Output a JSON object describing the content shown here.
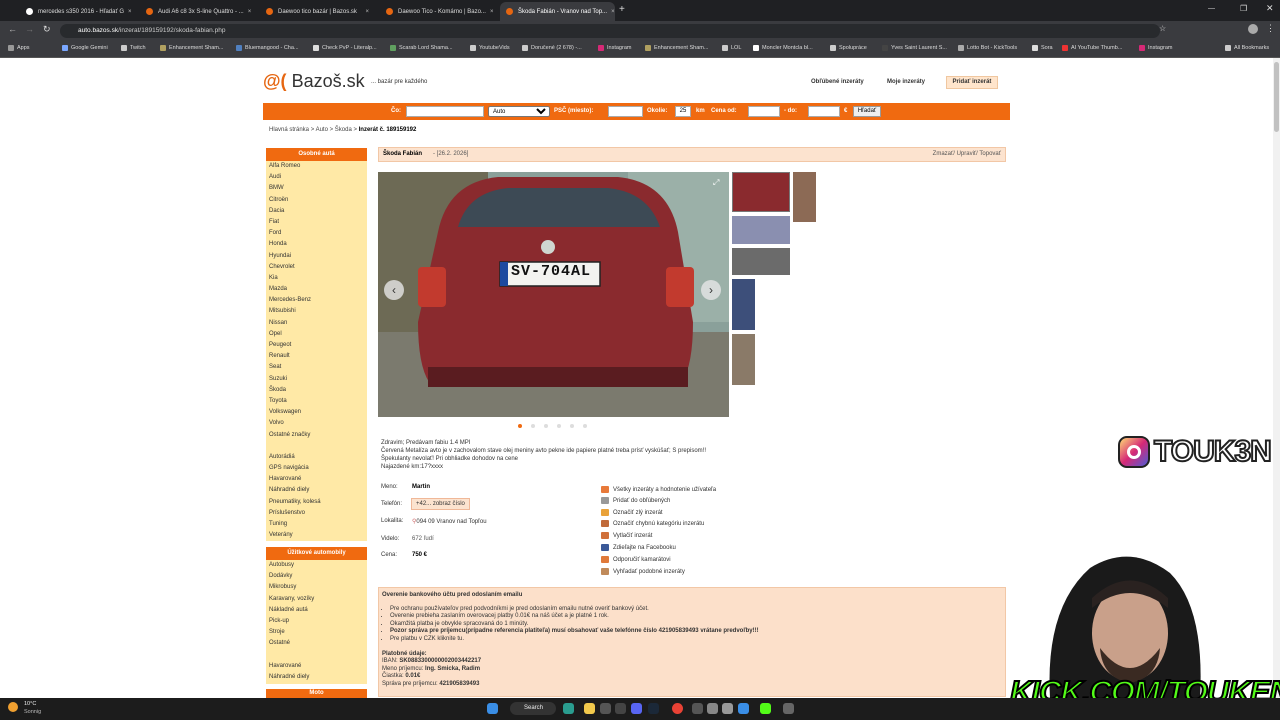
{
  "browser": {
    "tabs": [
      {
        "title": "mercedes s350 2016 - Hľadať G",
        "active": false
      },
      {
        "title": "Audi A6 c8 3x S-line Quattro - ...",
        "active": false
      },
      {
        "title": "Daewoo tico bazár | Bazos.sk",
        "active": false
      },
      {
        "title": "Daewoo Tico - Komárno | Bazo...",
        "active": false
      },
      {
        "title": "Škoda Fabián - Vranov nad Top...",
        "active": true
      }
    ],
    "new_tab": "+",
    "url_host": "auto.bazos.sk",
    "url_path": "/inzerat/189159192/skoda-fabian.php",
    "bookmarks": [
      "Apps",
      "Google Gemini",
      "Twitch",
      "Enhancement Sham...",
      "Bluemangood - Cha...",
      "Check PvP - Literalp...",
      "Scarab Lord Shama...",
      "YoutubeVids",
      "Doručené (2 678) -...",
      "Instagram",
      "Enhancement Sham...",
      "LOL",
      "Moncler Montcla bl...",
      "Spolupráce",
      "Yves Saint Laurent S...",
      "Lotto Bot - KickTools",
      "Sora",
      "AI YouTube Thumb...",
      "Instagram"
    ],
    "all_bookmarks": "All Bookmarks"
  },
  "site": {
    "logo_symbol": "@(",
    "logo_text": "Bazoš.sk",
    "tagline": "... bazár pre každého",
    "links": {
      "favorites": "Obľúbené inzeráty",
      "mine": "Moje inzeráty",
      "add": "Pridať inzerát"
    }
  },
  "search": {
    "what_label": "Čo:",
    "category": "Auto",
    "psc_label": "PSČ (miesto):",
    "radius_label": "Okolie:",
    "radius": "25",
    "km": "km",
    "price_label": "Cena od:",
    "to_label": "- do:",
    "currency": "€",
    "button": "Hľadať"
  },
  "breadcrumb": {
    "home": "Hlavná stránka",
    "sep1": ">",
    "auto": "Auto",
    "sep2": ">",
    "brand": "Škoda",
    "sep3": ">",
    "current": "Inzerát č. 189159192"
  },
  "sidebar": {
    "section1_title": "Osobné autá",
    "section1": [
      "Alfa Romeo",
      "Audi",
      "BMW",
      "Citroën",
      "Dacia",
      "Fiat",
      "Ford",
      "Honda",
      "Hyundai",
      "Chevrolet",
      "Kia",
      "Mazda",
      "Mercedes-Benz",
      "Mitsubishi",
      "Nissan",
      "Opel",
      "Peugeot",
      "Renault",
      "Seat",
      "Suzuki",
      "Škoda",
      "Toyota",
      "Volkswagen",
      "Volvo",
      "Ostatné značky",
      "",
      "Autorádiá",
      "GPS navigácia",
      "Havarované",
      "Náhradné diely",
      "Pneumatiky, kolesá",
      "Príslušenstvo",
      "Tuning",
      "Veterány"
    ],
    "section2_title": "Úžitkové automobily",
    "section2": [
      "Autobusy",
      "Dodávky",
      "Mikrobusy",
      "Karavany, vozíky",
      "Nákladné autá",
      "Pick-up",
      "Stroje",
      "Ostatné",
      "",
      "Havarované",
      "Náhradné diely"
    ],
    "section3_title": "Moto"
  },
  "listing": {
    "title": "Škoda Fabián",
    "date": "- [26.2. 2026]",
    "actions": "Zmazať/ Upraviť/ Topovať",
    "plate": "SV-704AL",
    "prev": "‹",
    "next": "›",
    "description": [
      "Zdravim; Predávam fabiu 1.4 MPI",
      "Červená Metalíza avto je v zachovalom stave olej meniny avto pekne ide papiere platné treba prísť vyskúšať; S prepisom!!",
      "Špekulanty nevolať! Pri obhliadke dohodov na cene",
      "Najazdené km:17?xxxx"
    ],
    "name_label": "Meno:",
    "name": "Martin",
    "phone_label": "Telefón:",
    "phone": "+42... zobraz číslo",
    "location_label": "Lokalita:",
    "location": "094 09 Vranov nad Topľou",
    "views_label": "Videlo:",
    "views": "672 ľudí",
    "price_label": "Cena:",
    "price": "750 €",
    "side_actions": [
      "Všetky inzeráty a hodnotenie užívateľa",
      "Pridať do obľúbených",
      "Označiť zlý inzerát",
      "Označiť chybnú kategóriu inzerátu",
      "Vytlačiť inzerát",
      "Zdieľajte na Facebooku",
      "Odporučiť kamarátovi",
      "Vyhľadať podobné inzeráty"
    ]
  },
  "bank": {
    "title": "Overenie bankového účtu pred odoslaním emailu",
    "items": [
      "Pre ochranu používateľov pred podvodníkmi je pred odoslaním emailu nutné overiť bankový účet.",
      "Overenie prebieha zaslaním overovacej platby 0.01€ na náš účet a je platné 1 rok.",
      "Okamžitá platba je obvykle spracovaná do 1 minúty.",
      "Pozor správa pre príjemcu(prípadne referencia platiteľa) musí obsahovať vaše telefónne číslo 421905839493 vrátane predvoľby!!!",
      "Pre platbu v CZK kliknite tu."
    ],
    "pay_title": "Platobné údaje:",
    "iban_label": "IBAN:",
    "iban": "SK0883300000002003442217",
    "recipient_label": "Meno príjemcu:",
    "recipient": "Ing. Smicka, Radim",
    "amount_label": "Čiastka:",
    "amount": "0.01€",
    "message_label": "Správa pre príjemcu:",
    "message": "421905839493"
  },
  "overlay": {
    "ig_handle": "TOUK3N",
    "kick": "KICK.COM/TOUKEN"
  },
  "taskbar": {
    "temp": "10°C",
    "weather": "Sonnig",
    "search": "Search"
  },
  "colors": {
    "accent": "#f06a10",
    "sidebar_bg": "#ffe9a6",
    "header_bg": "#fce3cf",
    "kick_green": "#53fc18"
  }
}
